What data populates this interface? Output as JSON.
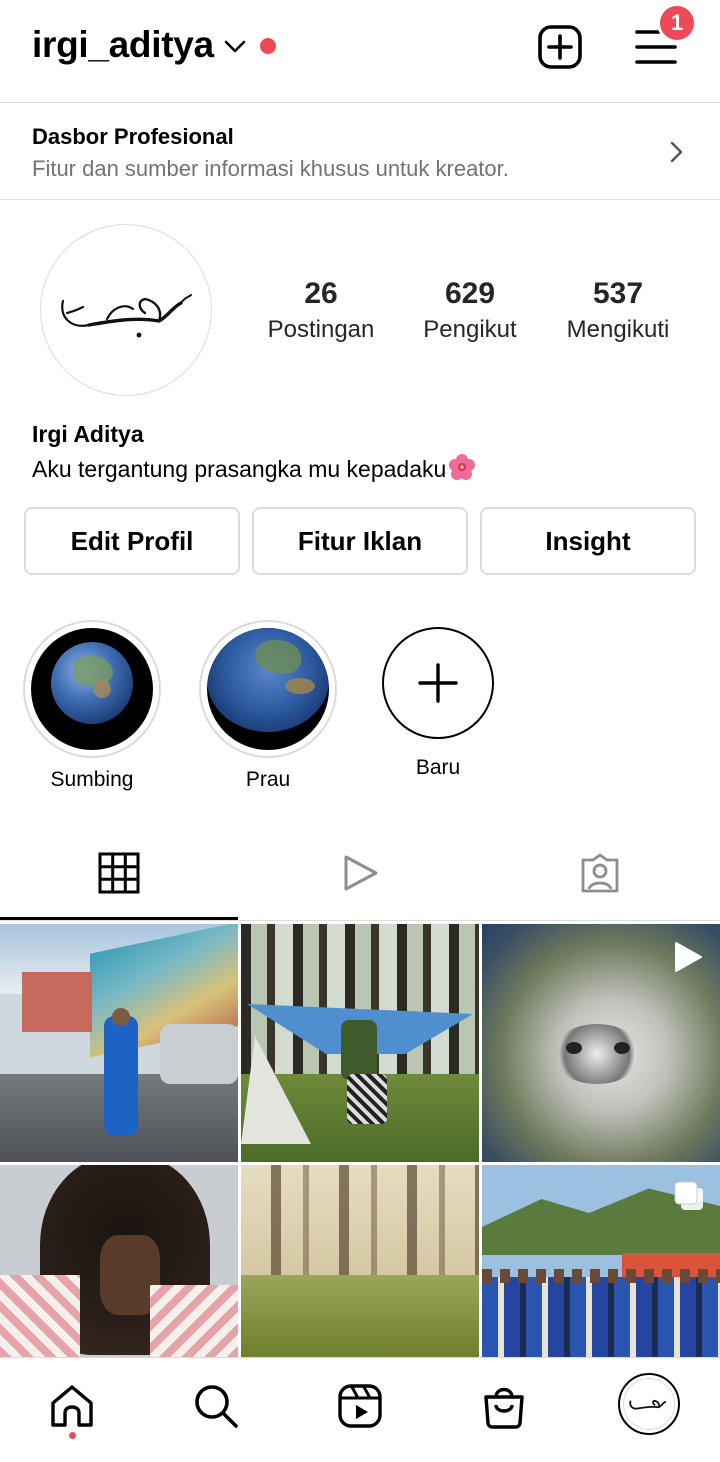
{
  "header": {
    "username": "irgi_aditya",
    "notification_count": "1"
  },
  "dashboard": {
    "title": "Dasbor Profesional",
    "subtitle": "Fitur dan sumber informasi khusus untuk kreator."
  },
  "profile": {
    "full_name": "Irgi Aditya",
    "bio": "Aku tergantung prasangka mu kepadaku",
    "stats": [
      {
        "value": "26",
        "label": "Postingan"
      },
      {
        "value": "629",
        "label": "Pengikut"
      },
      {
        "value": "537",
        "label": "Mengikuti"
      }
    ]
  },
  "buttons": {
    "edit_profile": "Edit Profil",
    "ads": "Fitur Iklan",
    "insight": "Insight"
  },
  "highlights": [
    {
      "label": "Sumbing"
    },
    {
      "label": "Prau"
    }
  ],
  "new_highlight_label": "Baru",
  "tabs": [
    "grid-tab",
    "reels-tab",
    "tagged-tab"
  ],
  "grid": [
    {
      "name": "post-campus",
      "type": "photo"
    },
    {
      "name": "post-hammock",
      "type": "photo"
    },
    {
      "name": "post-cat",
      "type": "video"
    },
    {
      "name": "post-curly-hair",
      "type": "photo"
    },
    {
      "name": "post-forest",
      "type": "photo"
    },
    {
      "name": "post-group",
      "type": "carousel"
    }
  ],
  "colors": {
    "accent_red": "#ed4956",
    "border": "#dbdbdb",
    "secondary_text": "#737373"
  }
}
